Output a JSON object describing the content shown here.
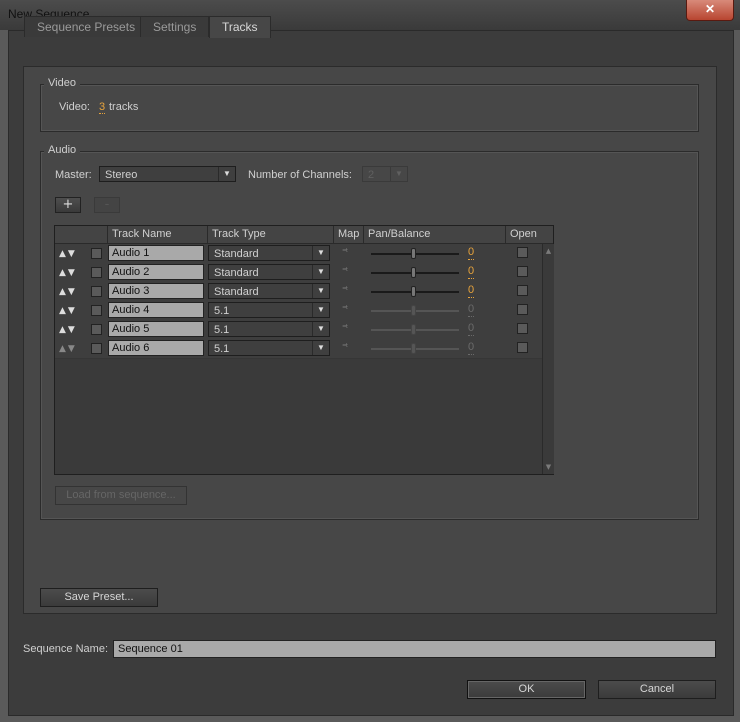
{
  "window": {
    "title": "New Sequence",
    "close_glyph": "✕"
  },
  "tabs": [
    {
      "label": "Sequence Presets"
    },
    {
      "label": "Settings"
    },
    {
      "label": "Tracks"
    }
  ],
  "video": {
    "group_label": "Video",
    "label": "Video:",
    "track_count": "3",
    "suffix": "tracks"
  },
  "audio": {
    "group_label": "Audio",
    "master_label": "Master:",
    "master_value": "Stereo",
    "channels_label": "Number of Channels:",
    "channels_value": "2",
    "add_label": "+",
    "remove_label": "-",
    "load_button": "Load from sequence...",
    "columns": [
      "Track Name",
      "Track Type",
      "Map",
      "Pan/Balance",
      "Open"
    ],
    "tracks": [
      {
        "name": "Audio 1",
        "type": "Standard",
        "pan": "0",
        "enabled": true
      },
      {
        "name": "Audio 2",
        "type": "Standard",
        "pan": "0",
        "enabled": true
      },
      {
        "name": "Audio 3",
        "type": "Standard",
        "pan": "0",
        "enabled": true
      },
      {
        "name": "Audio 4",
        "type": "5.1",
        "pan": "0",
        "enabled": false
      },
      {
        "name": "Audio 5",
        "type": "5.1",
        "pan": "0",
        "enabled": false
      },
      {
        "name": "Audio 6",
        "type": "5.1",
        "pan": "0",
        "enabled": false
      }
    ]
  },
  "save_preset_button": "Save Preset...",
  "sequence_name": {
    "label": "Sequence Name:",
    "value": "Sequence 01"
  },
  "ok_button": "OK",
  "cancel_button": "Cancel",
  "icons": {
    "move_up": "▲",
    "move_down": "▼",
    "dropdown_arrow": "▼",
    "scroll_up": "▲",
    "scroll_down": "▼",
    "map": "⁼ᵗ"
  }
}
